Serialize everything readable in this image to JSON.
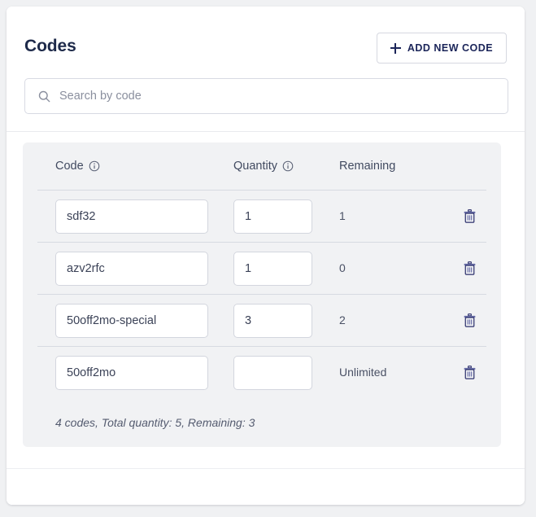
{
  "header": {
    "title": "Codes",
    "add_button": {
      "label": "ADD NEW CODE",
      "icon": "plus-icon"
    }
  },
  "search": {
    "placeholder": "Search by code",
    "value": "",
    "icon": "search-icon"
  },
  "table": {
    "columns": [
      {
        "key": "code",
        "label": "Code",
        "info_icon": "info-icon"
      },
      {
        "key": "quantity",
        "label": "Quantity",
        "info_icon": "info-icon"
      },
      {
        "key": "remaining",
        "label": "Remaining",
        "info_icon": null
      }
    ],
    "rows": [
      {
        "code": "sdf32",
        "quantity": "1",
        "remaining": "1",
        "delete_icon": "trash-icon"
      },
      {
        "code": "azv2rfc",
        "quantity": "1",
        "remaining": "0",
        "delete_icon": "trash-icon"
      },
      {
        "code": "50off2mo-special",
        "quantity": "3",
        "remaining": "2",
        "delete_icon": "trash-icon"
      },
      {
        "code": "50off2mo",
        "quantity": "",
        "remaining": "Unlimited",
        "delete_icon": "trash-icon"
      }
    ],
    "quantity_placeholder": "",
    "summary": "4 codes, Total quantity: 5, Remaining: 3"
  },
  "colors": {
    "accent_navy": "#1b2559",
    "page_bg": "#f0f1f3",
    "panel_bg": "#f1f2f4",
    "card_bg": "#ffffff",
    "border": "#d3d6de",
    "text_primary": "#1e2a4a",
    "text_secondary": "#4a5165",
    "placeholder": "#8a8f9e"
  }
}
